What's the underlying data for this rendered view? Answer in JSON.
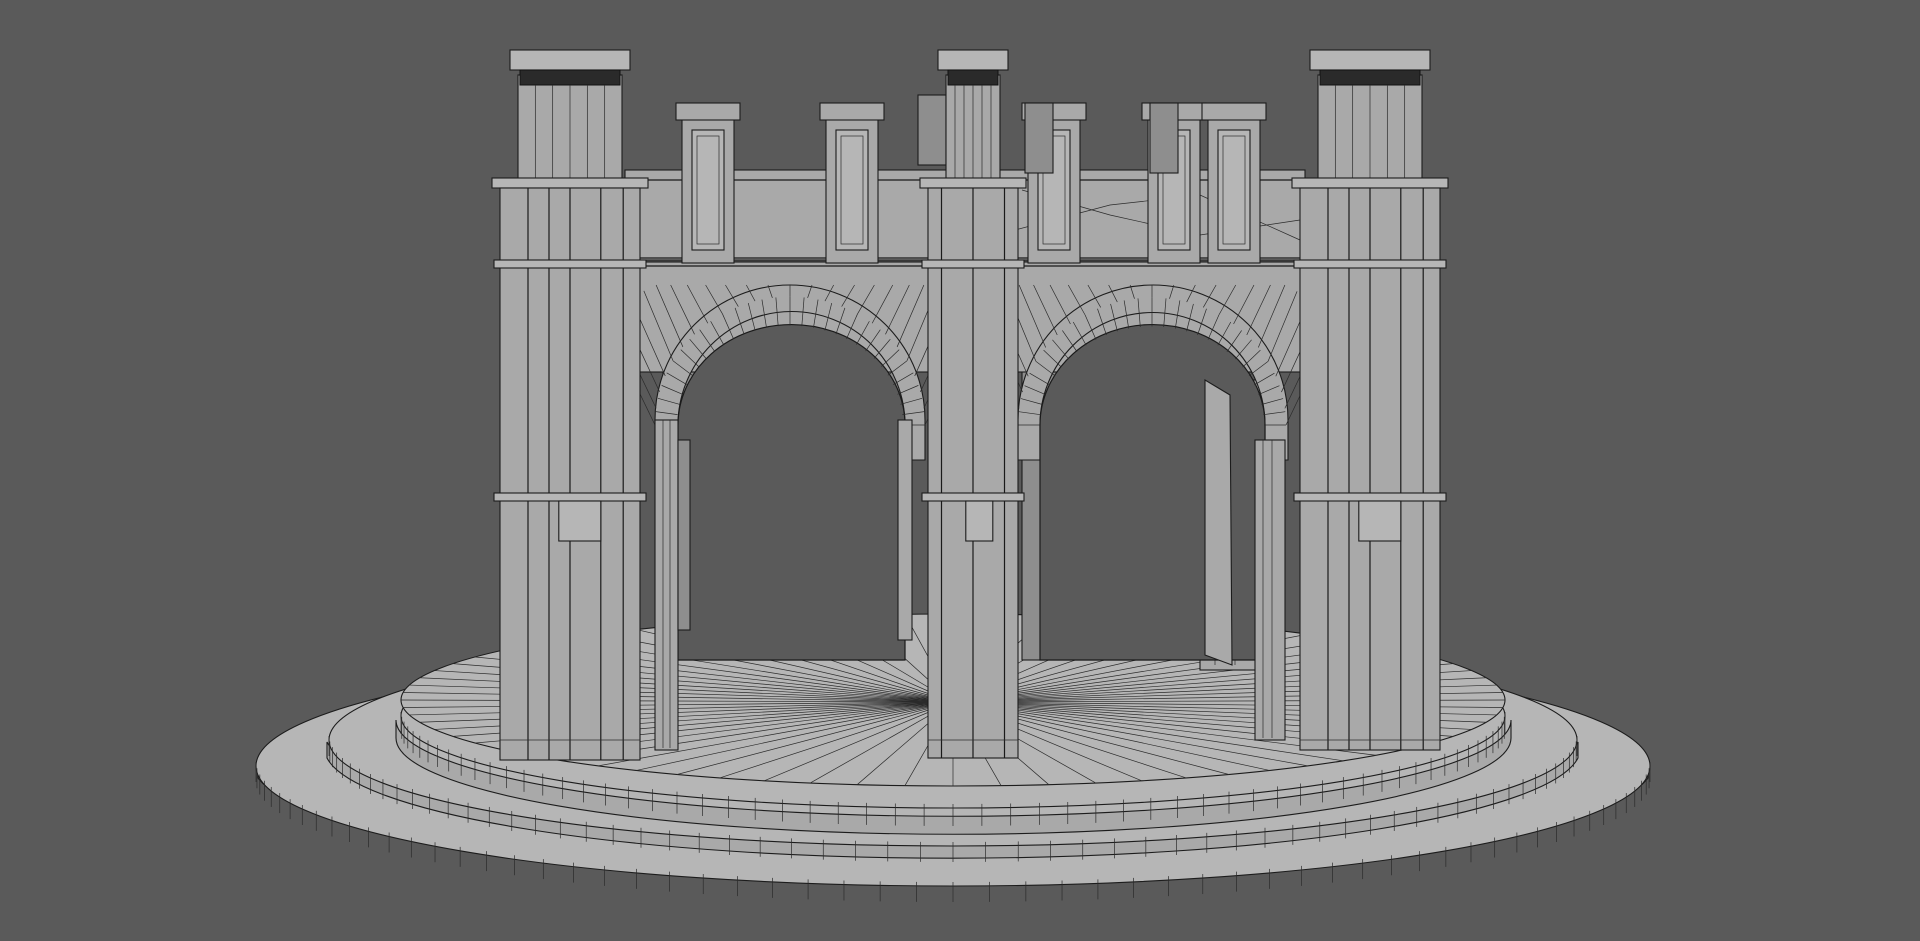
{
  "scene": {
    "background_color": "#5a5a5a",
    "model_color": "#a9a9a9",
    "wire_color": "#1c1c1c",
    "render_mode": "wireframe-on-shaded"
  }
}
